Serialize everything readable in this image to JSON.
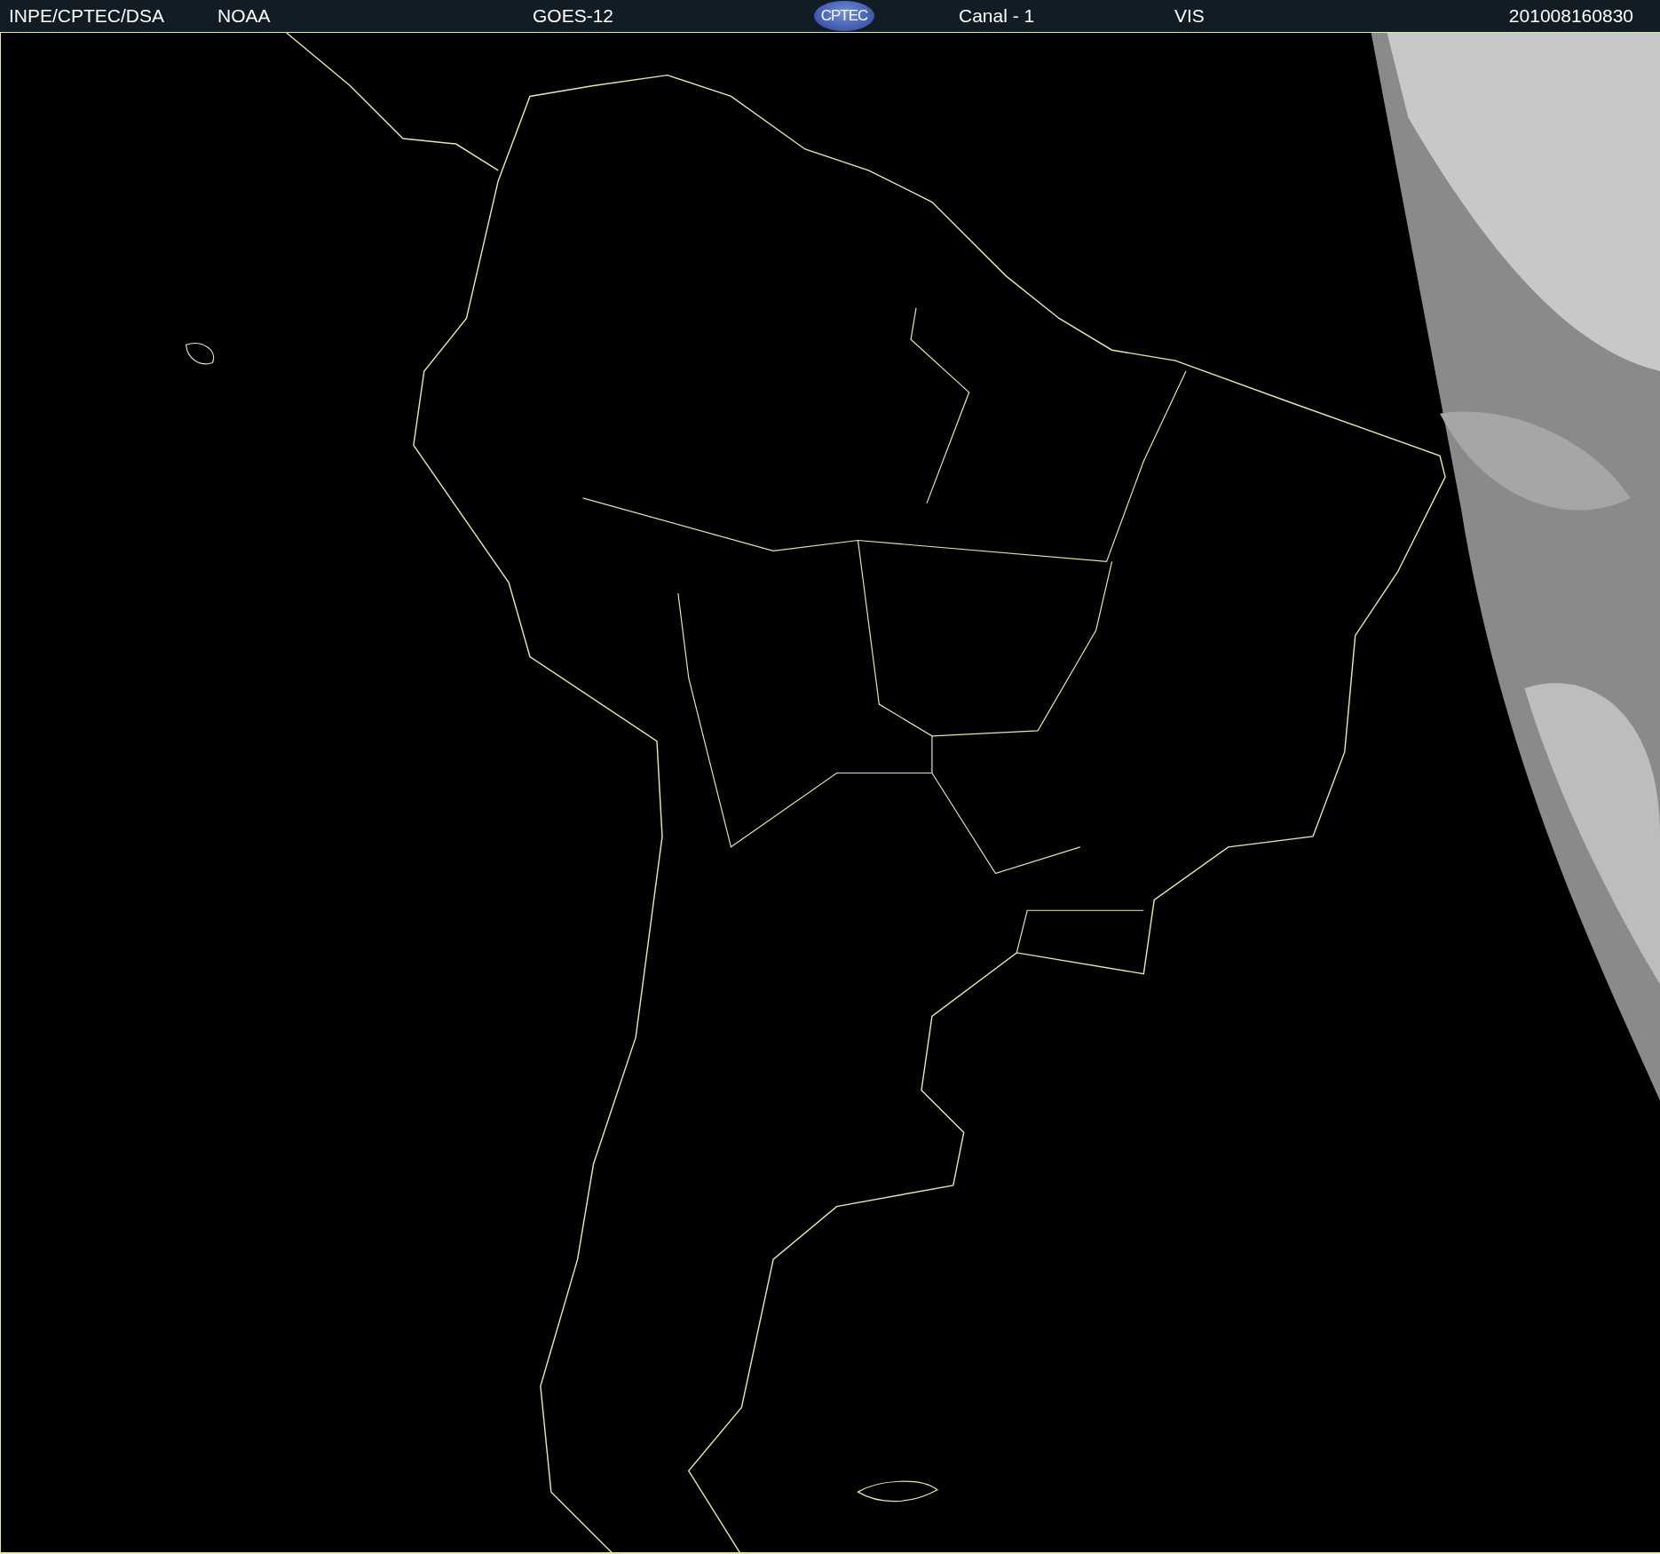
{
  "header": {
    "items": [
      {
        "kind": "text",
        "text": "INPE/CPTEC/DSA"
      },
      {
        "kind": "text",
        "text": "NOAA"
      },
      {
        "kind": "text",
        "text": "GOES-12"
      },
      {
        "kind": "logo",
        "text": "CPTEC"
      },
      {
        "kind": "text",
        "text": "Canal - 1"
      },
      {
        "kind": "text",
        "text": "VIS"
      },
      {
        "kind": "text",
        "text": "201008160830"
      }
    ]
  }
}
